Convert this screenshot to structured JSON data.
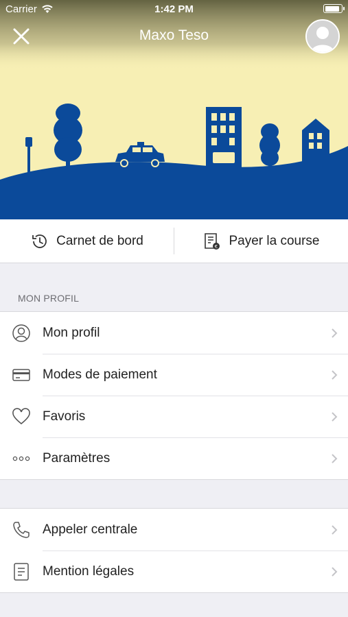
{
  "status_bar": {
    "carrier": "Carrier",
    "time": "1:42 PM",
    "battery_level": 0.95
  },
  "header": {
    "title": "Maxo Teso"
  },
  "colors": {
    "sky": "#f7efb4",
    "brand_blue": "#0b4a9a",
    "header_text": "#ffffff"
  },
  "actions": [
    {
      "label": "Carnet de bord",
      "icon": "history-clock-icon"
    },
    {
      "label": "Payer la course",
      "icon": "pay-receipt-icon"
    }
  ],
  "profile_section": {
    "title": "MON PROFIL",
    "items": [
      {
        "label": "Mon profil",
        "icon": "user-icon"
      },
      {
        "label": "Modes de paiement",
        "icon": "credit-card-icon"
      },
      {
        "label": "Favoris",
        "icon": "heart-icon"
      },
      {
        "label": "Paramètres",
        "icon": "more-dots-icon"
      }
    ]
  },
  "support_section": {
    "items": [
      {
        "label": "Appeler centrale",
        "icon": "phone-icon"
      },
      {
        "label": "Mention légales",
        "icon": "document-icon"
      }
    ]
  }
}
